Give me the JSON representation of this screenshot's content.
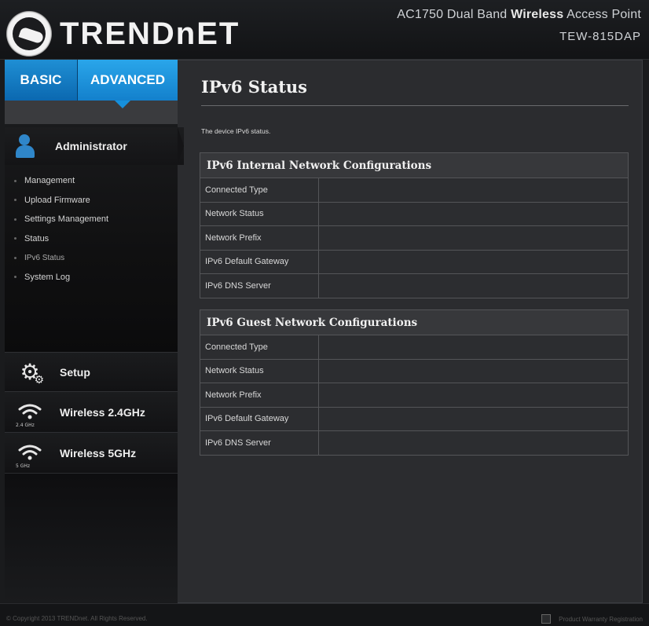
{
  "header": {
    "brand": "TRENDnET",
    "product_line_prefix": "AC1750 Dual Band ",
    "product_line_bold": "Wireless",
    "product_line_suffix": " Access Point",
    "model": "TEW-815DAP"
  },
  "tabs": {
    "basic": "BASIC",
    "advanced": "ADVANCED"
  },
  "sidebar": {
    "admin_label": "Administrator",
    "admin_items": [
      {
        "label": "Management"
      },
      {
        "label": "Upload Firmware"
      },
      {
        "label": "Settings Management"
      },
      {
        "label": "Status"
      },
      {
        "label": "IPv6 Status"
      },
      {
        "label": "System Log"
      }
    ],
    "setup_label": "Setup",
    "wireless24_label": "Wireless 2.4GHz",
    "wireless24_band": "2.4 GHz",
    "wireless5_label": "Wireless 5GHz",
    "wireless5_band": "5 GHz"
  },
  "main": {
    "title": "IPv6 Status",
    "description": "The device IPv6 status.",
    "internal": {
      "heading": "IPv6 Internal Network Configurations",
      "rows": [
        {
          "label": "Connected Type",
          "value": ""
        },
        {
          "label": "Network Status",
          "value": ""
        },
        {
          "label": "Network Prefix",
          "value": ""
        },
        {
          "label": "IPv6 Default Gateway",
          "value": ""
        },
        {
          "label": "IPv6 DNS Server",
          "value": ""
        }
      ]
    },
    "guest": {
      "heading": "IPv6 Guest Network Configurations",
      "rows": [
        {
          "label": "Connected Type",
          "value": ""
        },
        {
          "label": "Network Status",
          "value": ""
        },
        {
          "label": "Network Prefix",
          "value": ""
        },
        {
          "label": "IPv6 Default Gateway",
          "value": ""
        },
        {
          "label": "IPv6 DNS Server",
          "value": ""
        }
      ]
    }
  },
  "footer": {
    "copyright": "© Copyright 2013 TRENDnet. All Rights Reserved.",
    "warranty": "Product Warranty Registration"
  },
  "colors": {
    "accent": "#1a8fd6",
    "background": "#2b2c2f",
    "sidebar": "#0b0b0c"
  }
}
